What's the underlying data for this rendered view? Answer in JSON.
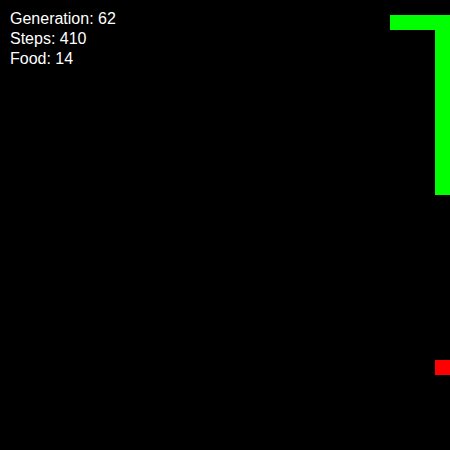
{
  "hud": {
    "generation": "Generation: 62",
    "steps": "Steps: 410",
    "food": "Food: 14"
  },
  "snake": {
    "color": "#00ff00",
    "segments": [
      [
        26,
        1
      ],
      [
        27,
        1
      ],
      [
        28,
        1
      ],
      [
        29,
        1
      ],
      [
        29,
        2
      ],
      [
        29,
        3
      ],
      [
        29,
        4
      ],
      [
        29,
        5
      ],
      [
        29,
        6
      ],
      [
        29,
        7
      ],
      [
        29,
        8
      ],
      [
        29,
        9
      ],
      [
        29,
        10
      ],
      [
        29,
        11
      ],
      [
        29,
        12
      ]
    ]
  },
  "food": {
    "color": "#ff0000",
    "cell": [
      29,
      24
    ]
  }
}
